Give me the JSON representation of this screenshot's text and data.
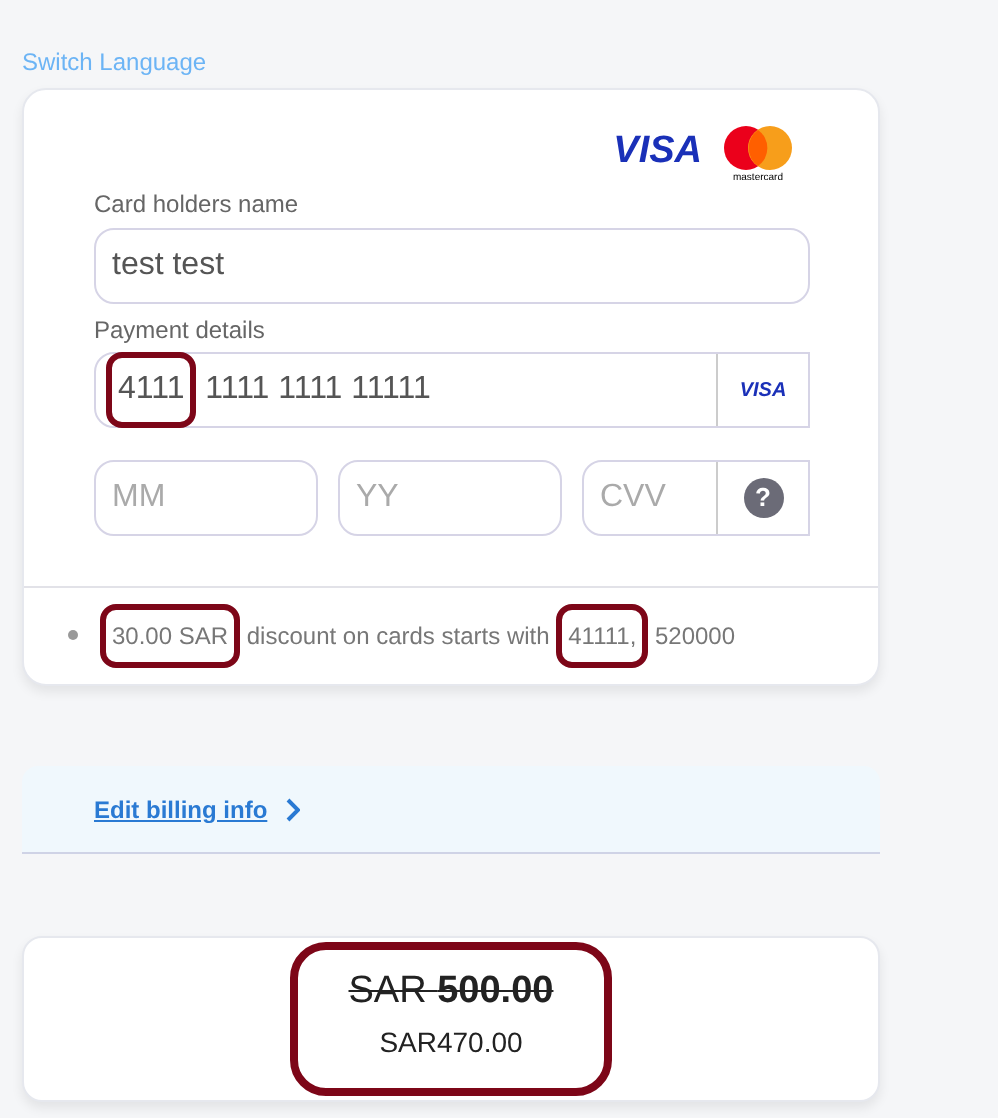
{
  "switch_language": "Switch Language",
  "card_logos": {
    "visa": "VISA",
    "mastercard": "mastercard"
  },
  "name_field": {
    "label": "Card holders name",
    "value": "test test"
  },
  "payment": {
    "label": "Payment details",
    "card_number": [
      {
        "text": "4111",
        "highlighted": true
      },
      {
        "text": " 1111 1111 11111",
        "highlighted": false
      }
    ],
    "card_brand": "VISA"
  },
  "expiry": [
    {
      "placeholder": "MM"
    },
    {
      "placeholder": "YY"
    }
  ],
  "cvv": {
    "placeholder": "CVV",
    "help": "?"
  },
  "discount": [
    {
      "text": "30.00 SAR",
      "highlighted": true
    },
    {
      "text": " discount on cards starts with ",
      "highlighted": false
    },
    {
      "text": "41111,",
      "highlighted": true
    },
    {
      "text": " 520000",
      "highlighted": false
    }
  ],
  "billing_link": "Edit billing info",
  "price": {
    "original": "SAR **500.00**",
    "discounted": "SAR470.00",
    "highlighted": true
  }
}
